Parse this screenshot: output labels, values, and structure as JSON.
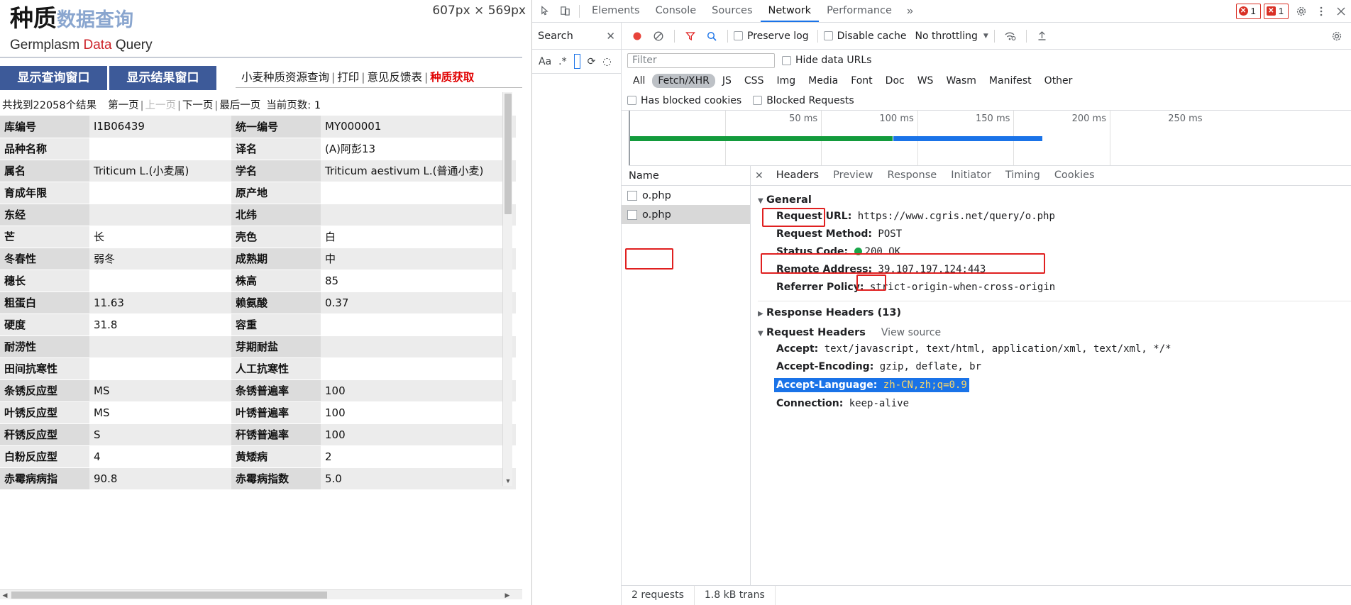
{
  "page": {
    "logo": {
      "bold": "种质",
      "light": "数据查询",
      "sub_pre": "Germplasm ",
      "sub_red": "Data",
      "sub_post": " Query"
    },
    "tabs": [
      {
        "label": "显示查询窗口",
        "name": "show-query-window"
      },
      {
        "label": "显示结果窗口",
        "name": "show-result-window"
      }
    ],
    "topnav": {
      "item1": "小麦种质资源查询",
      "item2": "打印",
      "item3": "意见反馈表",
      "item4": "种质获取",
      "sep": "|"
    },
    "pager": {
      "count": "共找到22058个结果",
      "first": "第一页",
      "prev": "上一页",
      "next": "下一页",
      "last": "最后一页",
      "current_label": "当前页数:",
      "current_value": "1",
      "sep": "|"
    },
    "size_badge": "607px × 569px",
    "table": {
      "rows": [
        {
          "k1": "库编号",
          "v1": "I1B06439",
          "k2": "统一编号",
          "v2": "MY000001"
        },
        {
          "k1": "品种名称",
          "v1": "",
          "k2": "译名",
          "v2": "(A)阿彭13"
        },
        {
          "k1": "属名",
          "v1": "Triticum L.(小麦属)",
          "k2": "学名",
          "v2": "Triticum aestivum L.(普通小麦)"
        },
        {
          "k1": "育成年限",
          "v1": "",
          "k2": "原产地",
          "v2": ""
        },
        {
          "k1": "东经",
          "v1": "",
          "k2": "北纬",
          "v2": ""
        },
        {
          "k1": "芒",
          "v1": "长",
          "k2": "壳色",
          "v2": "白"
        },
        {
          "k1": "冬春性",
          "v1": "弱冬",
          "k2": "成熟期",
          "v2": "中"
        },
        {
          "k1": "穗长",
          "v1": "",
          "k2": "株高",
          "v2": "85"
        },
        {
          "k1": "粗蛋白",
          "v1": "11.63",
          "k2": "赖氨酸",
          "v2": "0.37"
        },
        {
          "k1": "硬度",
          "v1": "31.8",
          "k2": "容重",
          "v2": ""
        },
        {
          "k1": "耐涝性",
          "v1": "",
          "k2": "芽期耐盐",
          "v2": ""
        },
        {
          "k1": "田间抗寒性",
          "v1": "",
          "k2": "人工抗寒性",
          "v2": ""
        },
        {
          "k1": "条锈反应型",
          "v1": "MS",
          "k2": "条锈普遍率",
          "v2": "100"
        },
        {
          "k1": "叶锈反应型",
          "v1": "MS",
          "k2": "叶锈普遍率",
          "v2": "100"
        },
        {
          "k1": "秆锈反应型",
          "v1": "S",
          "k2": "秆锈普遍率",
          "v2": "100"
        },
        {
          "k1": "白粉反应型",
          "v1": "4",
          "k2": "黄矮病",
          "v2": "2"
        },
        {
          "k1": "赤霉病病指",
          "v1": "90.8",
          "k2": "赤霉病指数",
          "v2": "5.0"
        }
      ]
    }
  },
  "devtools": {
    "tabs": [
      {
        "label": "Elements",
        "active": false
      },
      {
        "label": "Console",
        "active": false
      },
      {
        "label": "Sources",
        "active": false
      },
      {
        "label": "Network",
        "active": true
      },
      {
        "label": "Performance",
        "active": false
      }
    ],
    "more_label": "»",
    "error_count": "1",
    "warning_count": "1",
    "search_panel": {
      "title": "Search",
      "close": "✕",
      "match_case": "Aa",
      "regex": ".*"
    },
    "network_toolbar": {
      "preserve_log": "Preserve log",
      "disable_cache": "Disable cache",
      "throttling": "No throttling"
    },
    "filter": {
      "placeholder": "Filter",
      "hide_data_urls": "Hide data URLs"
    },
    "type_chips": [
      {
        "label": "All",
        "active": false
      },
      {
        "label": "Fetch/XHR",
        "active": true
      },
      {
        "label": "JS",
        "active": false
      },
      {
        "label": "CSS",
        "active": false
      },
      {
        "label": "Img",
        "active": false
      },
      {
        "label": "Media",
        "active": false
      },
      {
        "label": "Font",
        "active": false
      },
      {
        "label": "Doc",
        "active": false
      },
      {
        "label": "WS",
        "active": false
      },
      {
        "label": "Wasm",
        "active": false
      },
      {
        "label": "Manifest",
        "active": false
      },
      {
        "label": "Other",
        "active": false
      }
    ],
    "blocked": {
      "has_blocked_cookies": "Has blocked cookies",
      "blocked_requests": "Blocked Requests"
    },
    "timeline": {
      "ticks": [
        "50 ms",
        "100 ms",
        "150 ms",
        "200 ms",
        "250 ms"
      ]
    },
    "name_column_header": "Name",
    "requests": [
      {
        "name": "o.php",
        "selected": false
      },
      {
        "name": "o.php",
        "selected": true
      }
    ],
    "detail_tabs": [
      {
        "label": "Headers",
        "active": true
      },
      {
        "label": "Preview",
        "active": false
      },
      {
        "label": "Response",
        "active": false
      },
      {
        "label": "Initiator",
        "active": false
      },
      {
        "label": "Timing",
        "active": false
      },
      {
        "label": "Cookies",
        "active": false
      }
    ],
    "general": {
      "title": "General",
      "request_url_key": "Request URL:",
      "request_url_val": "https://www.cgris.net/query/o.php",
      "request_method_key": "Request Method:",
      "request_method_val": "POST",
      "status_code_key": "Status Code:",
      "status_code_val": "200",
      "status_code_text": "OK",
      "remote_address_key": "Remote Address:",
      "remote_address_val": "39.107.197.124:443",
      "referrer_policy_key": "Referrer Policy:",
      "referrer_policy_val": "strict-origin-when-cross-origin"
    },
    "response_headers_title": "Response Headers (13)",
    "request_headers_title": "Request Headers",
    "view_source": "View source",
    "request_headers": [
      {
        "key": "Accept:",
        "value": "text/javascript, text/html, application/xml, text/xml, */*",
        "selected": false
      },
      {
        "key": "Accept-Encoding:",
        "value": "gzip, deflate, br",
        "selected": false
      },
      {
        "key": "Accept-Language:",
        "value": "zh-CN,zh;q=0.9",
        "selected": true
      },
      {
        "key": "Connection:",
        "value": "keep-alive",
        "selected": false
      }
    ],
    "status_bar": {
      "requests": "2 requests",
      "transferred": "1.8 kB trans"
    }
  }
}
